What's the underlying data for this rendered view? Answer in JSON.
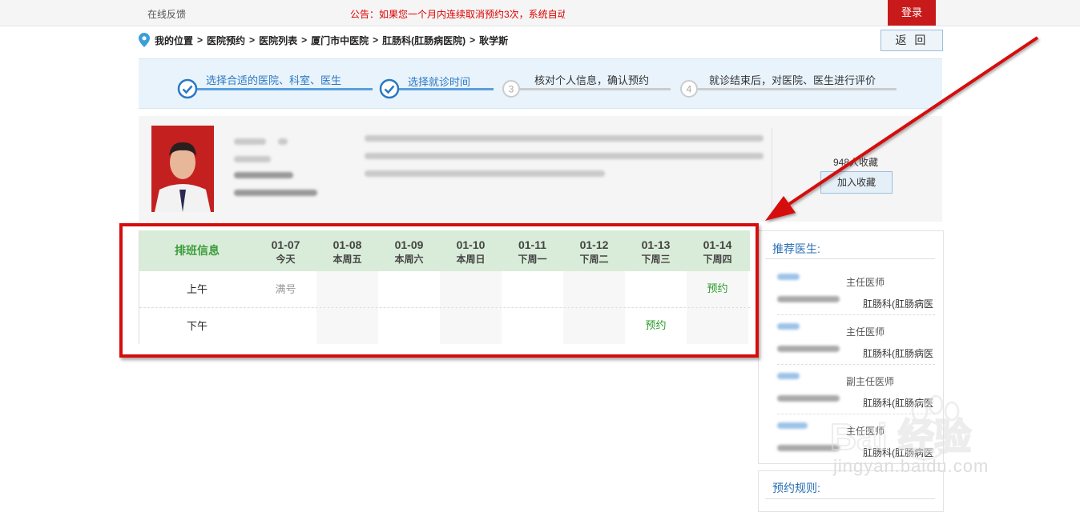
{
  "topbar": {
    "feedback": "在线反馈",
    "notice": "公告：如果您一个月内连续取消预约3次，系统自动",
    "login": "登录"
  },
  "breadcrumb": {
    "items": [
      "我的位置",
      "医院预约",
      "医院列表",
      "厦门市中医院",
      "肛肠科(肛肠病医院)",
      "耿学斯"
    ],
    "separator": ">"
  },
  "back_button": "返 回",
  "steps": [
    {
      "label": "选择合适的医院、科室、医生",
      "status": "done"
    },
    {
      "label": "选择就诊时间",
      "status": "done"
    },
    {
      "label": "核对个人信息，确认预约",
      "status": "todo",
      "number": "3"
    },
    {
      "label": "就诊结束后，对医院、医生进行评价",
      "status": "todo",
      "number": "4"
    }
  ],
  "doctor": {
    "favorites": "948人收藏",
    "add_favorite": "加入收藏"
  },
  "schedule": {
    "title": "排班信息",
    "days": [
      {
        "date": "01-07",
        "weekday": "今天"
      },
      {
        "date": "01-08",
        "weekday": "本周五"
      },
      {
        "date": "01-09",
        "weekday": "本周六"
      },
      {
        "date": "01-10",
        "weekday": "本周日"
      },
      {
        "date": "01-11",
        "weekday": "下周一"
      },
      {
        "date": "01-12",
        "weekday": "下周二"
      },
      {
        "date": "01-13",
        "weekday": "下周三"
      },
      {
        "date": "01-14",
        "weekday": "下周四"
      }
    ],
    "rows": [
      {
        "label": "上午",
        "cells": [
          "满号",
          "",
          "",
          "",
          "",
          "",
          "",
          "预约"
        ]
      },
      {
        "label": "下午",
        "cells": [
          "",
          "",
          "",
          "",
          "",
          "",
          "预约",
          ""
        ]
      }
    ]
  },
  "recommended": {
    "title": "推荐医生:",
    "doctors": [
      {
        "title": "主任医师",
        "dept": "肛肠科(肛肠病医"
      },
      {
        "title": "主任医师",
        "dept": "肛肠科(肛肠病医"
      },
      {
        "title": "副主任医师",
        "dept": "肛肠科(肛肠病医"
      },
      {
        "title": "主任医师",
        "dept": "肛肠科(肛肠病医"
      }
    ]
  },
  "rules": {
    "title": "预约规则:"
  },
  "watermark": {
    "text": "jingyan.baidu.com",
    "brand": "Bai 经验"
  },
  "colors": {
    "accent_red": "#c81a1a",
    "link_blue": "#2a78c4",
    "book_green": "#2a9a2a",
    "header_green": "#d9ecd9"
  }
}
